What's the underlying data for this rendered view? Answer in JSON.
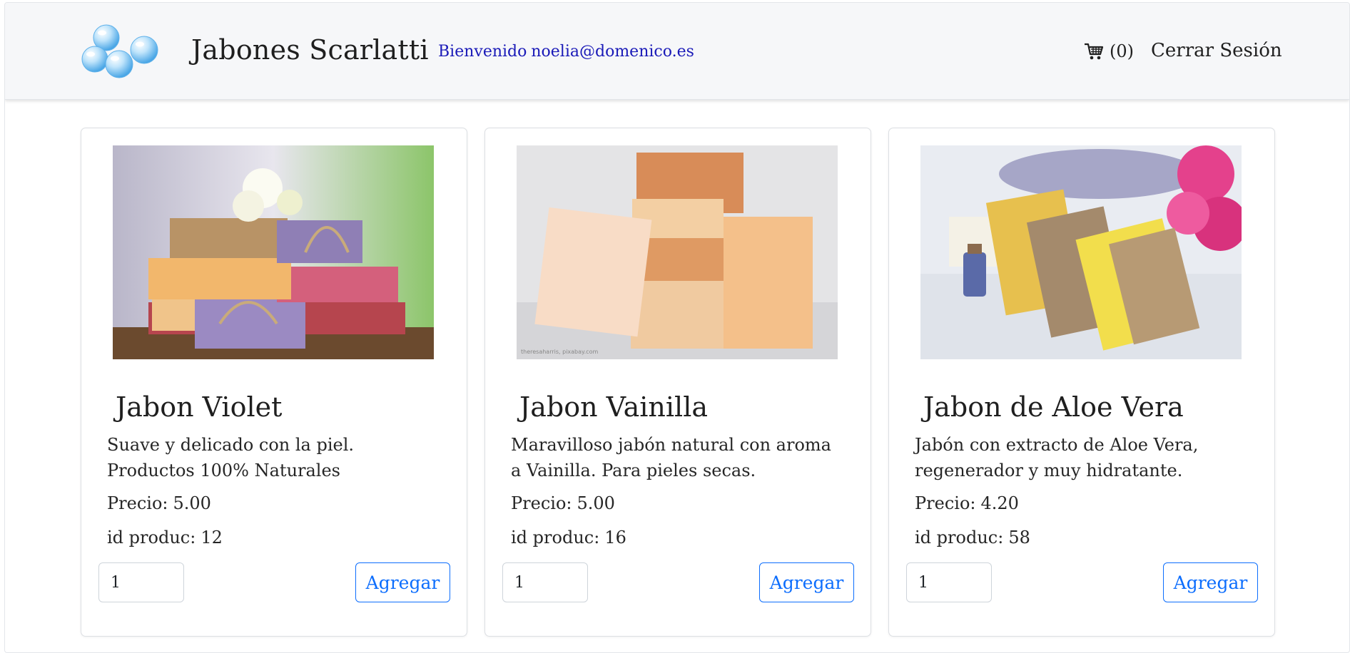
{
  "header": {
    "brand": "Jabones Scarlatti",
    "welcome_label": "Bienvenido",
    "user_email": "noelia@domenico.es",
    "cart_count": "(0)",
    "logout_label": "Cerrar Sesión"
  },
  "products": [
    {
      "name": "Jabon Violet",
      "description": "Suave y delicado con la piel. Productos 100% Naturales",
      "price_label": "Precio:",
      "price": "5.00",
      "id_label": "id produc:",
      "id": "12",
      "quantity": "1",
      "add_label": "Agregar"
    },
    {
      "name": "Jabon Vainilla",
      "description": "Maravilloso jabón natural con aroma a Vainilla. Para pieles secas.",
      "price_label": "Precio:",
      "price": "5.00",
      "id_label": "id produc:",
      "id": "16",
      "quantity": "1",
      "add_label": "Agregar"
    },
    {
      "name": "Jabon de Aloe Vera",
      "description": "Jabón con extracto de Aloe Vera, regenerador y muy hidratante.",
      "price_label": "Precio:",
      "price": "4.20",
      "id_label": "id produc:",
      "id": "58",
      "quantity": "1",
      "add_label": "Agregar"
    }
  ],
  "icons": {
    "logo": "soap-bubbles-logo",
    "cart": "cart-icon"
  },
  "colors": {
    "welcome_text": "#1a1ab8",
    "accent": "#0d6efd",
    "navbar_bg": "#f6f7f9"
  }
}
